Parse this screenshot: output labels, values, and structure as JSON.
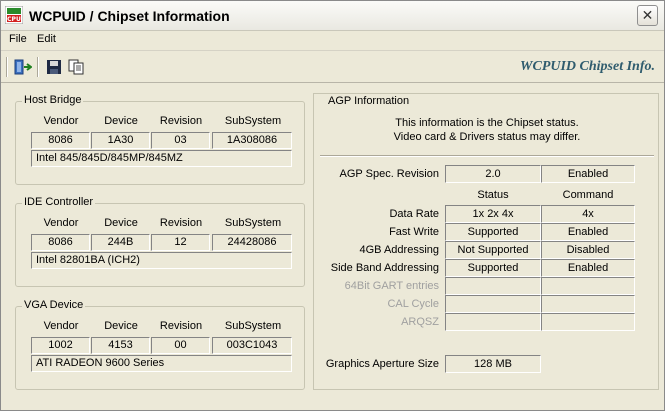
{
  "window": {
    "title": "WCPUID / Chipset Information"
  },
  "menu": {
    "file": "File",
    "edit": "Edit"
  },
  "toolbar": {
    "brand": "WCPUID  Chipset Info."
  },
  "columns": {
    "vendor": "Vendor",
    "device": "Device",
    "revision": "Revision",
    "subsystem": "SubSystem"
  },
  "host_bridge": {
    "label": "Host Bridge",
    "vendor": "8086",
    "device": "1A30",
    "revision": "03",
    "subsystem": "1A308086",
    "description": "Intel 845/845D/845MP/845MZ"
  },
  "ide_controller": {
    "label": "IDE Controller",
    "vendor": "8086",
    "device": "244B",
    "revision": "12",
    "subsystem": "24428086",
    "description": "Intel 82801BA (ICH2)"
  },
  "vga_device": {
    "label": "VGA Device",
    "vendor": "1002",
    "device": "4153",
    "revision": "00",
    "subsystem": "003C1043",
    "description": "ATI RADEON 9600 Series"
  },
  "agp": {
    "label": "AGP Information",
    "note_line1": "This information is the Chipset status.",
    "note_line2": "Video card & Drivers status may differ.",
    "spec_label": "AGP Spec. Revision",
    "spec_value": "2.0",
    "spec_status": "Enabled",
    "status_header": "Status",
    "command_header": "Command",
    "rows": [
      {
        "label": "Data Rate",
        "status": "1x 2x 4x",
        "command": "4x"
      },
      {
        "label": "Fast Write",
        "status": "Supported",
        "command": "Enabled"
      },
      {
        "label": "4GB Addressing",
        "status": "Not Supported",
        "command": "Disabled"
      },
      {
        "label": "Side Band Addressing",
        "status": "Supported",
        "command": "Enabled"
      },
      {
        "label": "64Bit GART entries",
        "status": "",
        "command": ""
      },
      {
        "label": "CAL Cycle",
        "status": "",
        "command": ""
      },
      {
        "label": "ARQSZ",
        "status": "",
        "command": ""
      }
    ],
    "aperture_label": "Graphics Aperture Size",
    "aperture_value": "128 MB"
  }
}
